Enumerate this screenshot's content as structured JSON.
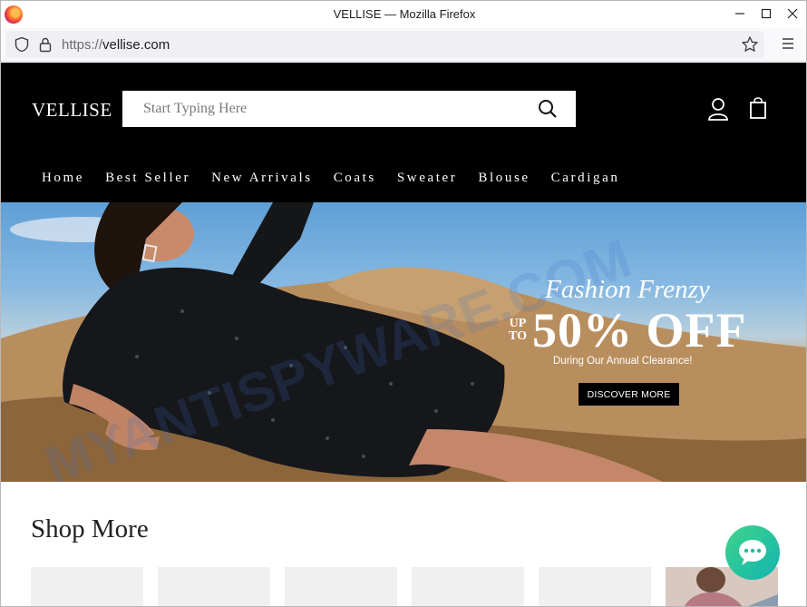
{
  "browser": {
    "window_title": "VELLISE — Mozilla Firefox",
    "url_scheme": "https://",
    "url_host": "vellise.com"
  },
  "site": {
    "logo": "VELLISE",
    "search_placeholder": "Start Typing Here",
    "nav": [
      "Home",
      "Best Seller",
      "New Arrivals",
      "Coats",
      "Sweater",
      "Blouse",
      "Cardigan"
    ]
  },
  "hero": {
    "headline": "Fashion Frenzy",
    "up_to_line1": "UP",
    "up_to_line2": "TO",
    "discount": "50% OFF",
    "subtext": "During Our Annual Clearance!",
    "cta": "DISCOVER MORE"
  },
  "section": {
    "title": "Shop More"
  },
  "watermark": "MYANTISPYWARE.COM",
  "colors": {
    "header_bg": "#000000",
    "chat_accent": "#22c49a"
  }
}
